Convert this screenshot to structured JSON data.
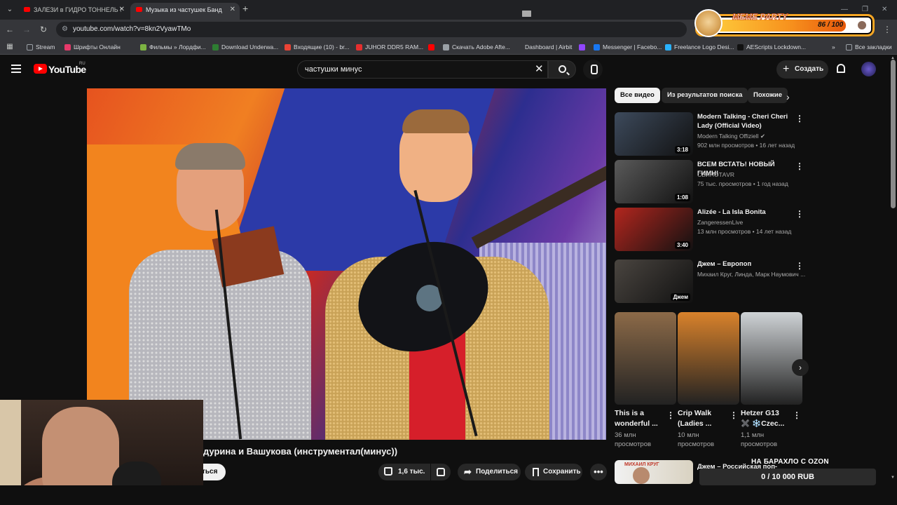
{
  "browser": {
    "tabs": [
      {
        "label": "ЗАЛЕЗИ в ГИДРО ТОННЕЛЬ !",
        "active": false
      },
      {
        "label": "Музыка из частушек Банд",
        "active": true
      }
    ],
    "url": "youtube.com/watch?v=8kn2VyawTMo",
    "bookmarks": [
      {
        "label": "Stream",
        "icon": "folder-icon",
        "color": "#9aa0a6"
      },
      {
        "label": "Шрифты Онлайн",
        "icon": "fonts-icon",
        "color": "#e6396a"
      },
      {
        "label": "Фильмы » Лордфи...",
        "icon": "film-icon",
        "color": "#7cb342"
      },
      {
        "label": "Download Underwa...",
        "icon": "download-icon",
        "color": "#2e7d32"
      },
      {
        "label": "Входящие (10) - br...",
        "icon": "gmail-icon",
        "color": "#ea4335"
      },
      {
        "label": "JUHOR DDR5 RAM...",
        "icon": "aliexpress-icon",
        "color": "#e62e2e"
      },
      {
        "label": "",
        "icon": "youtube-icon",
        "color": "#ff0000"
      },
      {
        "label": "Скачать Adobe Afte...",
        "icon": "globe-icon",
        "color": "#9aa0a6"
      },
      {
        "label": "Dashboard | Airbit",
        "icon": "airbit-icon",
        "color": "#35363a"
      },
      {
        "label": "",
        "icon": "twitch-icon",
        "color": "#9146ff"
      },
      {
        "label": "Messenger | Facebo...",
        "icon": "facebook-icon",
        "color": "#1877f2"
      },
      {
        "label": "Freelance Logo Desi...",
        "icon": "freelance-icon",
        "color": "#29b2fe"
      },
      {
        "label": "AEScripts Lockdown...",
        "icon": "aescripts-icon",
        "color": "#111111"
      }
    ],
    "all_bookmarks": "Все закладки"
  },
  "overlay": {
    "meme_title": "MEME PARTY",
    "meme_count": "86 / 100",
    "meme_progress": 0.86,
    "ozon_title": "НА БАРАХЛО С OZON",
    "ozon_amount": "0 / 10 000 RUB"
  },
  "youtube": {
    "logo": "YouTube",
    "region": "RU",
    "search_query": "частушки минус",
    "create_label": "Создать",
    "video_title": "дурина и Вашукова (инструментал(минус))",
    "subscribe_label": "ться",
    "likes": "1,6 тыс.",
    "share_label": "Поделиться",
    "save_label": "Сохранить",
    "chips": [
      "Все видео",
      "Из результатов поиска",
      "Похожие"
    ],
    "recommendations": [
      {
        "title": "Modern Talking - Cheri Cheri Lady (Official Video)",
        "channel": "Modern Talking Offiziell",
        "verified": true,
        "meta": "902 млн просмотров • 16 лет назад",
        "duration": "3:18",
        "thumb_color": "#3d4a5c"
      },
      {
        "title": "ВСЕМ ВСТАТЬ! НОВЫЙ ГИМН!",
        "channel": "СВИНОТАVR",
        "verified": false,
        "meta": "75 тыс. просмотров • 1 год назад",
        "duration": "1:08",
        "thumb_color": "#5a5a5a"
      },
      {
        "title": "Alizée - La Isla Bonita",
        "channel": "ZangeressenLive",
        "verified": false,
        "meta": "13 млн просмотров • 14 лет назад",
        "duration": "3:40",
        "thumb_color": "#b3261e"
      },
      {
        "title": "Джем – Европоп",
        "channel": "Михаил Круг, Линда, Марк Наумович ...",
        "verified": false,
        "meta": "",
        "duration": "Джем",
        "thumb_color": "#4a4540"
      }
    ],
    "shorts": [
      {
        "title": "This is a wonderful ...",
        "views": "36 млн просмотров",
        "thumb_color": "#8c6a48"
      },
      {
        "title": "Crip Walk (Ladies ...",
        "views": "10 млн просмотров",
        "thumb_color": "#d9822b"
      },
      {
        "title": "Hetzer G13 ✖️ ❄️Czec...",
        "views": "1,1 млн просмотров",
        "thumb_color": "#cfd3d6"
      }
    ],
    "last_rec": {
      "title": "Джем – Российская поп-",
      "thumb_text": "МИХАИЛ КРУГ"
    }
  }
}
